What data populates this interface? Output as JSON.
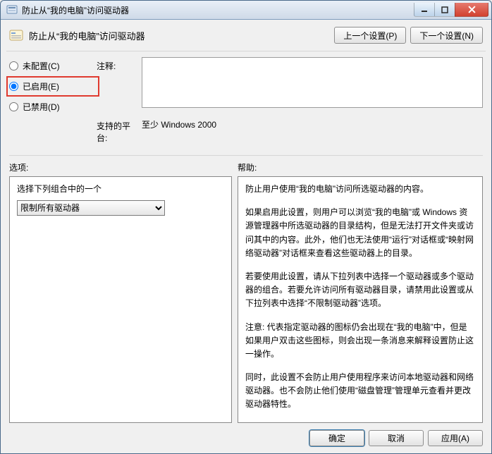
{
  "window": {
    "title": "防止从“我的电脑”访问驱动器"
  },
  "header": {
    "title": "防止从“我的电脑”访问驱动器",
    "prev_btn": "上一个设置(P)",
    "next_btn": "下一个设置(N)"
  },
  "status": {
    "not_configured": "未配置(C)",
    "enabled": "已启用(E)",
    "disabled": "已禁用(D)",
    "selected": "enabled"
  },
  "labels": {
    "comment": "注释:",
    "supported": "支持的平台:",
    "options": "选项:",
    "help": "帮助:"
  },
  "comment_text": "",
  "supported_text": "至少 Windows 2000",
  "options": {
    "prompt": "选择下列组合中的一个",
    "items": [
      "限制所有驱动器"
    ],
    "selected": "限制所有驱动器"
  },
  "help_paragraphs": [
    "防止用户使用“我的电脑”访问所选驱动器的内容。",
    "如果启用此设置，则用户可以浏览“我的电脑”或 Windows 资源管理器中所选驱动器的目录结构，但是无法打开文件夹或访问其中的内容。此外，他们也无法使用“运行”对话框或“映射网络驱动器”对话框来查看这些驱动器上的目录。",
    "若要使用此设置，请从下拉列表中选择一个驱动器或多个驱动器的组合。若要允许访问所有驱动器目录，请禁用此设置或从下拉列表中选择“不限制驱动器”选项。",
    "注意: 代表指定驱动器的图标仍会出现在“我的电脑”中，但是如果用户双击这些图标，则会出现一条消息来解释设置防止这一操作。",
    "同时，此设置不会防止用户使用程序来访问本地驱动器和网络驱动器。也不会防止他们使用“磁盘管理”管理单元查看并更改驱动器特性。"
  ],
  "footer": {
    "ok": "确定",
    "cancel": "取消",
    "apply": "应用(A)"
  }
}
